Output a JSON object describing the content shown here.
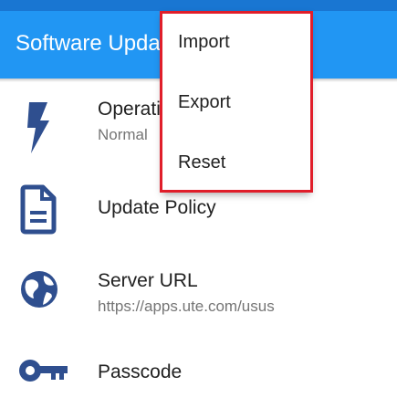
{
  "appbar": {
    "title": "Software Update"
  },
  "settings": [
    {
      "icon": "flash-icon",
      "title": "Operation Mode",
      "subtitle": "Normal"
    },
    {
      "icon": "document-icon",
      "title": "Update Policy",
      "subtitle": ""
    },
    {
      "icon": "globe-icon",
      "title": "Server URL",
      "subtitle": "https://apps.ute.com/usus"
    },
    {
      "icon": "key-icon",
      "title": "Passcode",
      "subtitle": ""
    }
  ],
  "menu": {
    "items": [
      {
        "label": "Import"
      },
      {
        "label": "Export"
      },
      {
        "label": "Reset"
      }
    ]
  },
  "colors": {
    "appbar": "#2196f3",
    "statusbar": "#1976d2",
    "icon": "#2f4f8f",
    "menu_highlight_border": "#e01e2a"
  }
}
